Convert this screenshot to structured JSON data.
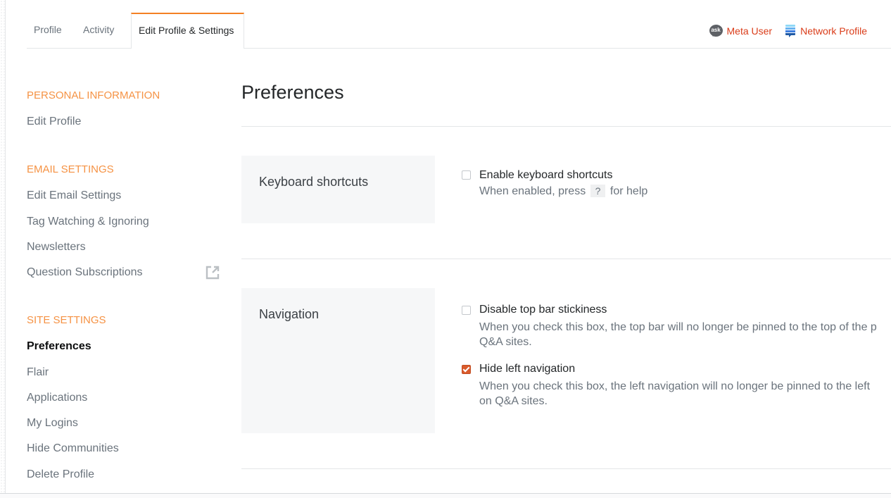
{
  "tabs": [
    {
      "label": "Profile",
      "active": false
    },
    {
      "label": "Activity",
      "active": false
    },
    {
      "label": "Edit Profile & Settings",
      "active": true
    }
  ],
  "header_links": {
    "meta_user": {
      "label": "Meta User",
      "icon": "ask-icon",
      "icon_text": "ask"
    },
    "network_profile": {
      "label": "Network Profile",
      "icon": "stack-exchange-icon"
    }
  },
  "sidebar": {
    "sections": [
      {
        "heading": "PERSONAL INFORMATION",
        "items": [
          {
            "label": "Edit Profile"
          }
        ]
      },
      {
        "heading": "EMAIL SETTINGS",
        "items": [
          {
            "label": "Edit Email Settings"
          },
          {
            "label": "Tag Watching & Ignoring"
          },
          {
            "label": "Newsletters"
          },
          {
            "label": "Question Subscriptions",
            "icon": "external-link-icon"
          }
        ]
      },
      {
        "heading": "SITE SETTINGS",
        "items": [
          {
            "label": "Preferences",
            "active": true
          },
          {
            "label": "Flair"
          },
          {
            "label": "Applications"
          },
          {
            "label": "My Logins"
          },
          {
            "label": "Hide Communities"
          },
          {
            "label": "Delete Profile"
          }
        ]
      }
    ]
  },
  "main": {
    "title": "Preferences",
    "sections": [
      {
        "title": "Keyboard shortcuts",
        "options": [
          {
            "label": "Enable keyboard shortcuts",
            "checked": false,
            "desc_before": "When enabled, press",
            "key": "?",
            "desc_after": "for help"
          }
        ]
      },
      {
        "title": "Navigation",
        "options": [
          {
            "label": "Disable top bar stickiness",
            "checked": false,
            "desc_line1": "When you check this box, the top bar will no longer be pinned to the top of the p",
            "desc_line2": "Q&A sites."
          },
          {
            "label": "Hide left navigation",
            "checked": true,
            "desc_line1": "When you check this box, the left navigation will no longer be pinned to the left",
            "desc_line2": "on Q&A sites."
          }
        ]
      }
    ]
  },
  "colors": {
    "accent": "#f48024",
    "link": "#da3c19",
    "checkbox_checked": "#da5b2c"
  }
}
